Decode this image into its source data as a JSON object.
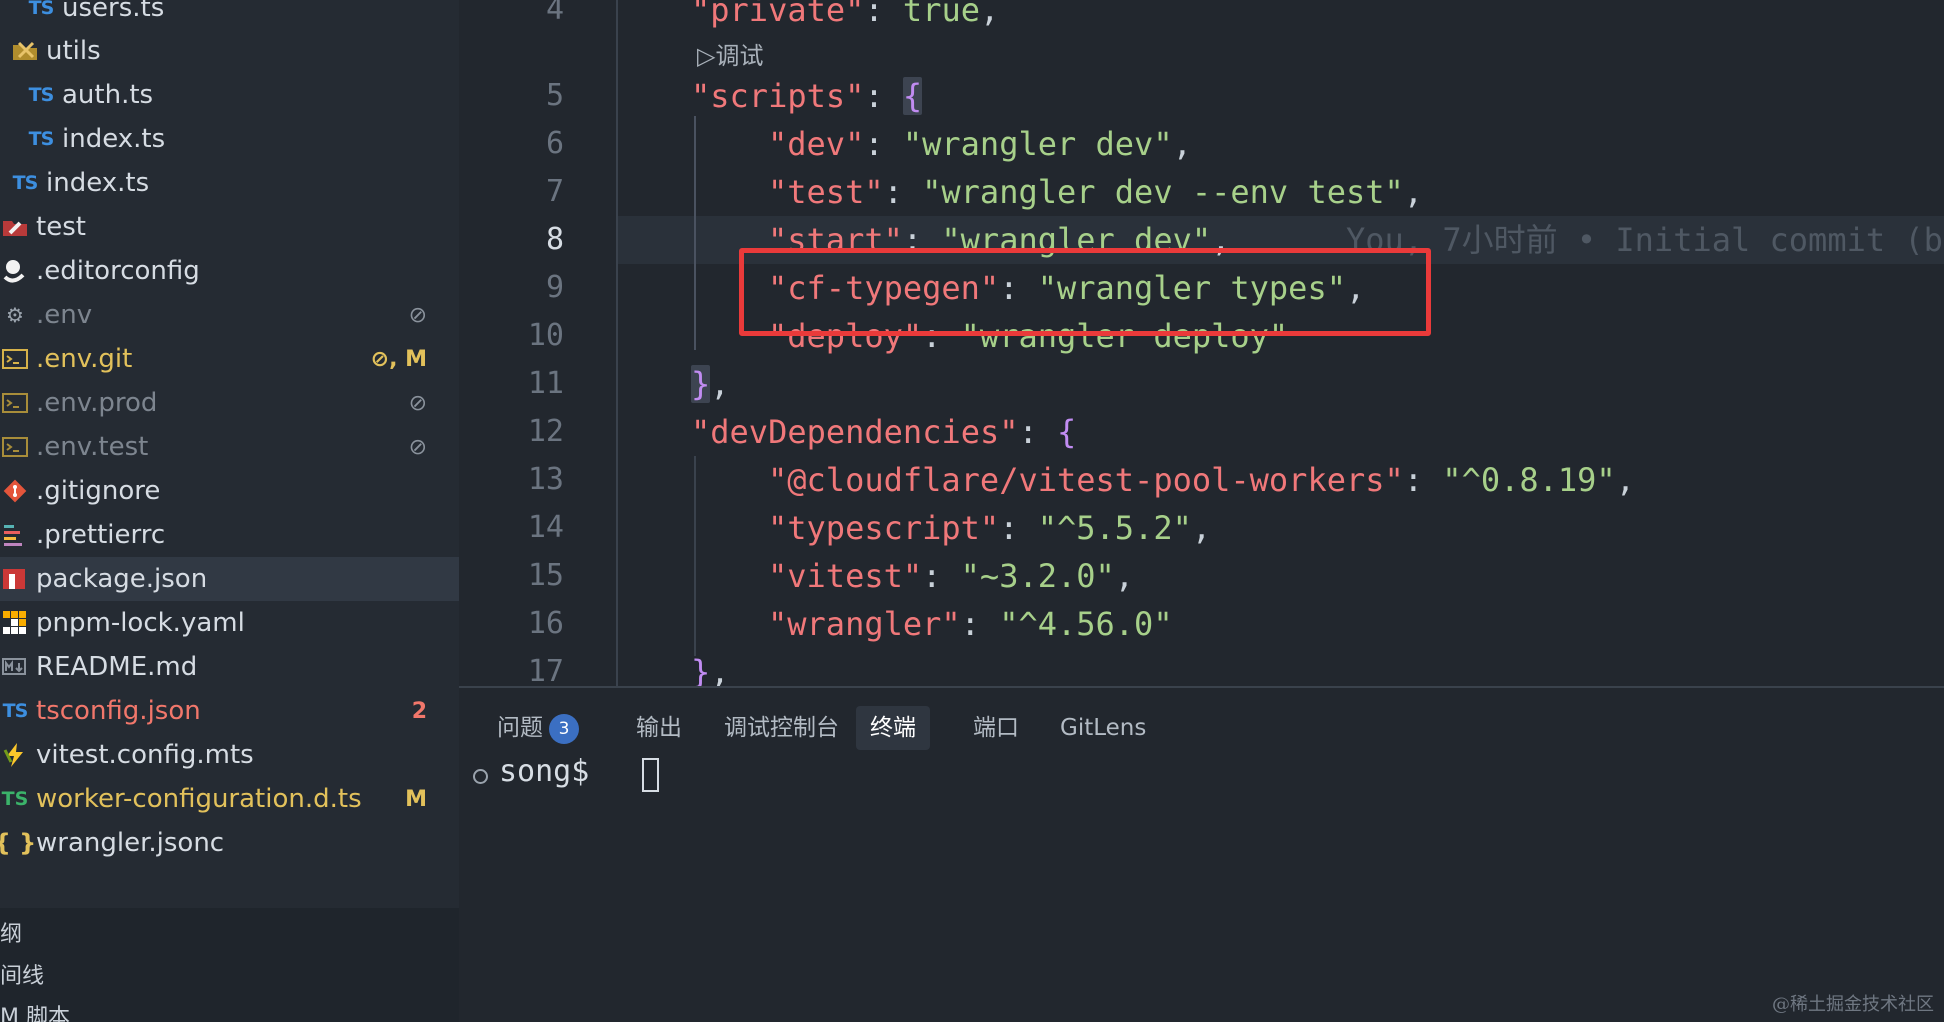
{
  "sidebar": {
    "items": [
      {
        "icon": "TS",
        "label": "users.ts",
        "deco": ""
      },
      {
        "icon": "utils",
        "label": "utils",
        "deco": ""
      },
      {
        "icon": "TS",
        "label": "auth.ts",
        "deco": ""
      },
      {
        "icon": "TS",
        "label": "index.ts",
        "deco": ""
      },
      {
        "icon": "TS",
        "label": "index.ts",
        "deco": ""
      },
      {
        "icon": "test",
        "label": "test",
        "deco": ""
      },
      {
        "icon": "editorconfig",
        "label": ".editorconfig",
        "deco": ""
      },
      {
        "icon": "gear",
        "label": ".env",
        "deco": "⊘"
      },
      {
        "icon": "terminal",
        "label": ".env.git",
        "deco": "⊘, M"
      },
      {
        "icon": "terminal",
        "label": ".env.prod",
        "deco": "⊘"
      },
      {
        "icon": "terminal",
        "label": ".env.test",
        "deco": "⊘"
      },
      {
        "icon": "git",
        "label": ".gitignore",
        "deco": ""
      },
      {
        "icon": "prettier",
        "label": ".prettierrc",
        "deco": ""
      },
      {
        "icon": "npm",
        "label": "package.json",
        "deco": ""
      },
      {
        "icon": "pnpm",
        "label": "pnpm-lock.yaml",
        "deco": ""
      },
      {
        "icon": "markdown",
        "label": "README.md",
        "deco": ""
      },
      {
        "icon": "TS",
        "label": "tsconfig.json",
        "deco": "2"
      },
      {
        "icon": "vitest",
        "label": "vitest.config.mts",
        "deco": ""
      },
      {
        "icon": "TS",
        "label": "worker-configuration.d.ts",
        "deco": "M"
      },
      {
        "icon": "braces",
        "label": "wrangler.jsonc",
        "deco": ""
      }
    ],
    "bottom": [
      "纲",
      "间线",
      "M 脚本"
    ]
  },
  "editor": {
    "line_numbers": [
      "4",
      "5",
      "6",
      "7",
      "8",
      "9",
      "10",
      "11",
      "12",
      "13",
      "14",
      "15",
      "16",
      "17"
    ],
    "codelens": "▷调试",
    "blame": "You, 7小时前 • Initial commit (b",
    "code": {
      "l4_key": "\"private\"",
      "l4_val": "true",
      "l5_key": "\"scripts\"",
      "l6_key": "\"dev\"",
      "l6_val": "\"wrangler dev\"",
      "l7_key": "\"test\"",
      "l7_val": "\"wrangler dev --env test\"",
      "l8_key": "\"start\"",
      "l8_val": "\"wrangler dev\"",
      "l9_key": "\"cf-typegen\"",
      "l9_val": "\"wrangler types\"",
      "l10_key": "\"deploy\"",
      "l10_val": "\"wrangler deploy\"",
      "l12_key": "\"devDependencies\"",
      "l13_key": "\"@cloudflare/vitest-pool-workers\"",
      "l13_val": "\"^0.8.19\"",
      "l14_key": "\"typescript\"",
      "l14_val": "\"^5.5.2\"",
      "l15_key": "\"vitest\"",
      "l15_val": "\"~3.2.0\"",
      "l16_key": "\"wrangler\"",
      "l16_val": "\"^4.56.0\""
    }
  },
  "panel": {
    "tabs": [
      "问题",
      "输出",
      "调试控制台",
      "终端",
      "端口",
      "GitLens"
    ],
    "problems_badge": "3",
    "active_tab": "终端",
    "prompt": "song$"
  },
  "watermark": "@稀土掘金技术社区"
}
